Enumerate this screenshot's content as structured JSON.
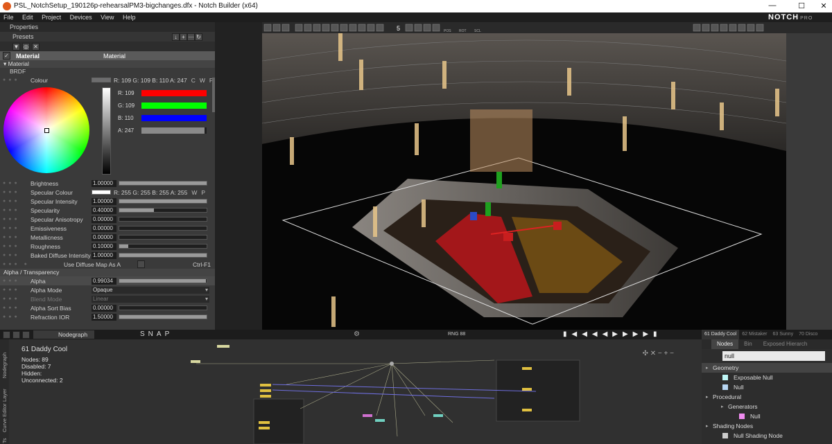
{
  "window": {
    "title": "PSL_NotchSetup_190126p-rehearsalPM3-bigchanges.dfx - Notch Builder (x64)",
    "minimize": "—",
    "maximize": "☐",
    "close": "✕"
  },
  "menu": [
    "File",
    "Edit",
    "Project",
    "Devices",
    "View",
    "Help"
  ],
  "logo": {
    "text": "NOTCH",
    "pro": "PRO"
  },
  "properties": {
    "title": "Properties",
    "presets_label": "Presets",
    "material_row": {
      "name": "Material",
      "type": "Material"
    },
    "section_material": "Material",
    "sub_brdf": "BRDF",
    "colour": {
      "label": "Colour",
      "value": "R: 109 G: 109 B: 110 A: 247",
      "c": "C",
      "w": "W",
      "p": "P"
    },
    "channels": [
      {
        "label": "R: 109",
        "color": "#ff0000",
        "fill": 1.0
      },
      {
        "label": "G: 109",
        "color": "#00ff00",
        "fill": 1.0
      },
      {
        "label": "B: 110",
        "color": "#0000ff",
        "fill": 1.0
      },
      {
        "label": "A: 247",
        "color": "#8a8a8a",
        "fill": 0.97
      }
    ],
    "brightness": {
      "label": "Brightness",
      "value": "1.00000",
      "fill": 1.0
    },
    "specular_colour": {
      "label": "Specular Colour",
      "value": "R: 255 G: 255 B: 255 A: 255",
      "c": "C",
      "w": "W",
      "p": "P"
    },
    "rows": [
      {
        "label": "Specular Intensity",
        "value": "1.00000",
        "fill": 1.0
      },
      {
        "label": "Specularity",
        "value": "0.40000",
        "fill": 0.4
      },
      {
        "label": "Specular Anisotropy",
        "value": "0.00000",
        "fill": 0.0
      },
      {
        "label": "Emissiveness",
        "value": "0.00000",
        "fill": 0.0
      },
      {
        "label": "Metallicness",
        "value": "0.00000",
        "fill": 0.0
      },
      {
        "label": "Roughness",
        "value": "0.10000",
        "fill": 0.1
      },
      {
        "label": "Baked Diffuse Intensity",
        "value": "1.00000",
        "fill": 1.0
      }
    ],
    "use_diffuse": {
      "label": "Use Diffuse Map As A",
      "shortcut": "Ctrl-F1"
    },
    "section_alpha": "Alpha / Transparency",
    "alpha": {
      "label": "Alpha",
      "value": "0.99034",
      "fill": 0.99
    },
    "alpha_mode": {
      "label": "Alpha Mode",
      "value": "Opaque"
    },
    "blend_mode": {
      "label": "Blend Mode",
      "value": "Linear"
    },
    "alpha_sort": {
      "label": "Alpha Sort Bias",
      "value": "0.00000",
      "fill": 0.0
    },
    "refraction": {
      "label": "Refraction IOR",
      "value": "1.50000",
      "fill": 1.0
    }
  },
  "viewport": {
    "toolbar_number": "5",
    "toolbar_pos": "POS",
    "toolbar_rot": "ROT",
    "toolbar_scl": "SCL"
  },
  "nodegraph": {
    "bar": {
      "tab": "Nodegraph",
      "snap": [
        "S",
        "N",
        "A",
        "P"
      ],
      "ring": "RNG",
      "ring_value": "88"
    },
    "title": "61 Daddy Cool",
    "stats": [
      "Nodes: 89",
      "Disabled: 7",
      "Hidden:",
      "Unconnected: 2"
    ],
    "side_tabs": [
      "Nodegraph",
      "Layer",
      "Curve Editor",
      "Ts"
    ]
  },
  "nodes_panel": {
    "layers": [
      "61 Daddy Cool",
      "62 Mistaker",
      "63 Sunny",
      "70 Disco"
    ],
    "tabs": [
      "Nodes",
      "Bin",
      "Exposed Hierarch"
    ],
    "search": "null",
    "tree": [
      {
        "label": "Geometry",
        "level": 0,
        "selected": true,
        "tri": "▸"
      },
      {
        "label": "Exposable Null",
        "level": 1,
        "color": "#bff7f7"
      },
      {
        "label": "Null",
        "level": 1,
        "color": "#b7d6f3"
      },
      {
        "label": "Procedural",
        "level": 0,
        "tri": "▸"
      },
      {
        "label": "Generators",
        "level": 1,
        "tri": "▸"
      },
      {
        "label": "Null",
        "level": 2,
        "color": "#f08cf0"
      },
      {
        "label": "Shading Nodes",
        "level": 0,
        "tri": "▸"
      },
      {
        "label": "Null Shading Node",
        "level": 1,
        "color": "#cccccc"
      }
    ]
  }
}
